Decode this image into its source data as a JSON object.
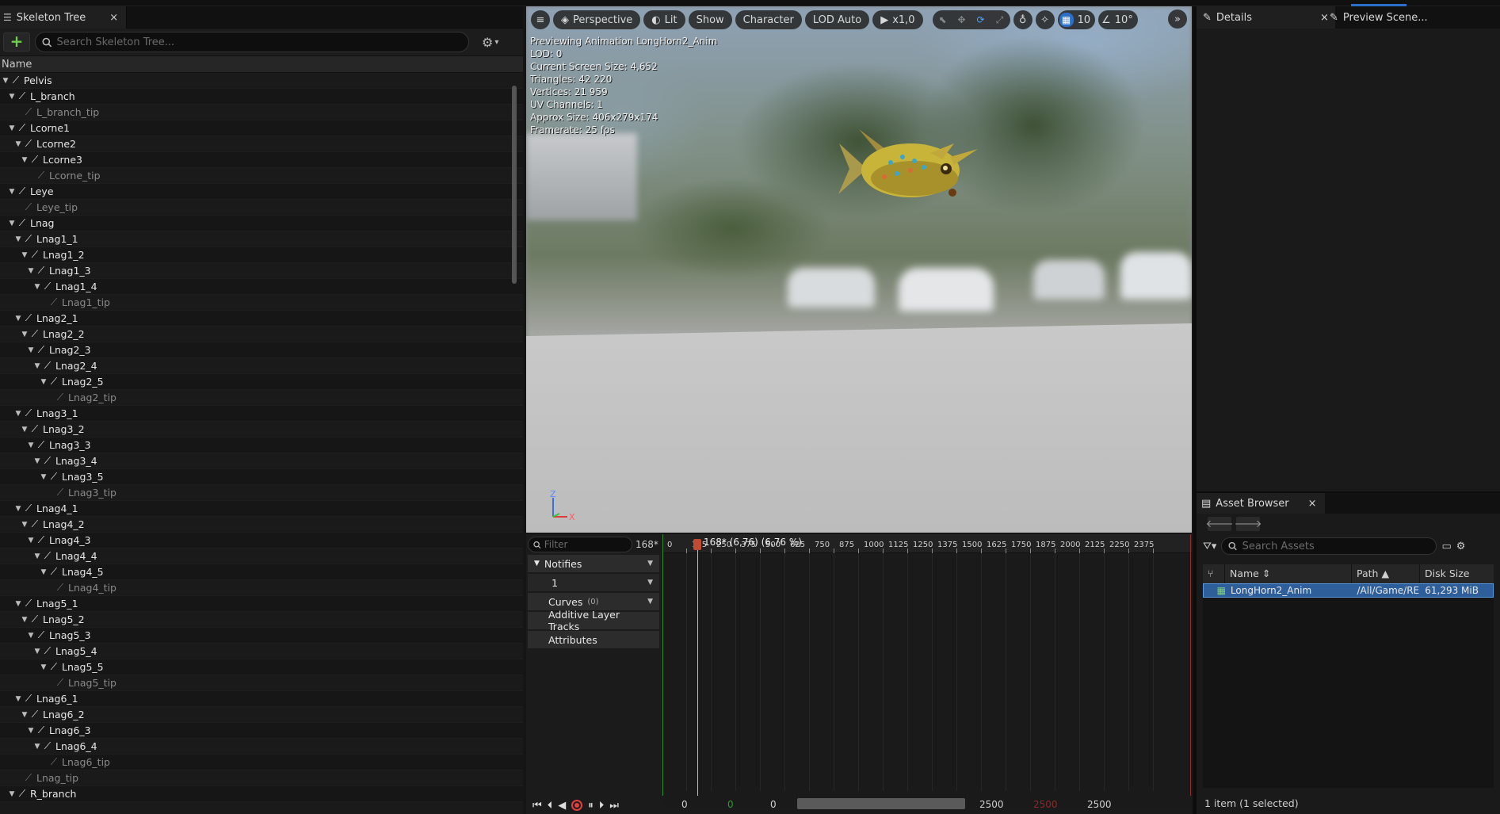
{
  "skeleton_tree": {
    "tab_label": "Skeleton Tree",
    "tab_close": "×",
    "add_label": "+",
    "search_placeholder": "Search Skeleton Tree...",
    "column_name": "Name",
    "bones": [
      {
        "label": "Pelvis",
        "depth": 0,
        "tip": false
      },
      {
        "label": "L_branch",
        "depth": 1,
        "tip": false
      },
      {
        "label": "L_branch_tip",
        "depth": 2,
        "tip": true
      },
      {
        "label": "Lcorne1",
        "depth": 1,
        "tip": false
      },
      {
        "label": "Lcorne2",
        "depth": 2,
        "tip": false
      },
      {
        "label": "Lcorne3",
        "depth": 3,
        "tip": false
      },
      {
        "label": "Lcorne_tip",
        "depth": 4,
        "tip": true
      },
      {
        "label": "Leye",
        "depth": 1,
        "tip": false
      },
      {
        "label": "Leye_tip",
        "depth": 2,
        "tip": true
      },
      {
        "label": "Lnag",
        "depth": 1,
        "tip": false
      },
      {
        "label": "Lnag1_1",
        "depth": 2,
        "tip": false
      },
      {
        "label": "Lnag1_2",
        "depth": 3,
        "tip": false
      },
      {
        "label": "Lnag1_3",
        "depth": 4,
        "tip": false
      },
      {
        "label": "Lnag1_4",
        "depth": 5,
        "tip": false
      },
      {
        "label": "Lnag1_tip",
        "depth": 6,
        "tip": true
      },
      {
        "label": "Lnag2_1",
        "depth": 2,
        "tip": false
      },
      {
        "label": "Lnag2_2",
        "depth": 3,
        "tip": false
      },
      {
        "label": "Lnag2_3",
        "depth": 4,
        "tip": false
      },
      {
        "label": "Lnag2_4",
        "depth": 5,
        "tip": false
      },
      {
        "label": "Lnag2_5",
        "depth": 6,
        "tip": false
      },
      {
        "label": "Lnag2_tip",
        "depth": 7,
        "tip": true
      },
      {
        "label": "Lnag3_1",
        "depth": 2,
        "tip": false
      },
      {
        "label": "Lnag3_2",
        "depth": 3,
        "tip": false
      },
      {
        "label": "Lnag3_3",
        "depth": 4,
        "tip": false
      },
      {
        "label": "Lnag3_4",
        "depth": 5,
        "tip": false
      },
      {
        "label": "Lnag3_5",
        "depth": 6,
        "tip": false
      },
      {
        "label": "Lnag3_tip",
        "depth": 7,
        "tip": true
      },
      {
        "label": "Lnag4_1",
        "depth": 2,
        "tip": false
      },
      {
        "label": "Lnag4_2",
        "depth": 3,
        "tip": false
      },
      {
        "label": "Lnag4_3",
        "depth": 4,
        "tip": false
      },
      {
        "label": "Lnag4_4",
        "depth": 5,
        "tip": false
      },
      {
        "label": "Lnag4_5",
        "depth": 6,
        "tip": false
      },
      {
        "label": "Lnag4_tip",
        "depth": 7,
        "tip": true
      },
      {
        "label": "Lnag5_1",
        "depth": 2,
        "tip": false
      },
      {
        "label": "Lnag5_2",
        "depth": 3,
        "tip": false
      },
      {
        "label": "Lnag5_3",
        "depth": 4,
        "tip": false
      },
      {
        "label": "Lnag5_4",
        "depth": 5,
        "tip": false
      },
      {
        "label": "Lnag5_5",
        "depth": 6,
        "tip": false
      },
      {
        "label": "Lnag5_tip",
        "depth": 7,
        "tip": true
      },
      {
        "label": "Lnag6_1",
        "depth": 2,
        "tip": false
      },
      {
        "label": "Lnag6_2",
        "depth": 3,
        "tip": false
      },
      {
        "label": "Lnag6_3",
        "depth": 4,
        "tip": false
      },
      {
        "label": "Lnag6_4",
        "depth": 5,
        "tip": false
      },
      {
        "label": "Lnag6_tip",
        "depth": 6,
        "tip": true
      },
      {
        "label": "Lnag_tip",
        "depth": 2,
        "tip": true
      },
      {
        "label": "R_branch",
        "depth": 1,
        "tip": false
      }
    ]
  },
  "viewport": {
    "menu_icon": "hamburger-icon",
    "perspective": "Perspective",
    "lit": "Lit",
    "show": "Show",
    "character": "Character",
    "lod": "LOD Auto",
    "play_speed": "x1,0",
    "grid_snap": "10",
    "angle_snap": "10°",
    "stats": [
      "Previewing Animation LongHorn2_Anim",
      "LOD: 0",
      "Current Screen Size: 4,652",
      "Triangles: 42 220",
      "Vertices: 21 959",
      "UV Channels: 1",
      "Approx Size: 406x279x174",
      "Framerate: 25 fps"
    ],
    "axis_z": "Z",
    "axis_x": "X"
  },
  "sequencer": {
    "filter_placeholder": "Filter",
    "frame_readout": "168*",
    "notifies": "Notifies",
    "notify_track": "1",
    "curves": "Curves",
    "curves_count": "(0)",
    "additive": "Additive Layer Tracks",
    "attributes": "Attributes",
    "playhead_label": "168* (6,76) (6,76 %)",
    "ruler_ticks": [
      "0",
      "125",
      "250",
      "375",
      "500",
      "625",
      "750",
      "875",
      "1000",
      "1125",
      "1250",
      "1375",
      "1500",
      "1625",
      "1750",
      "1875",
      "2000",
      "2125",
      "2250",
      "2375"
    ],
    "range_left": "0",
    "range_green": "0",
    "range_view_start": "0",
    "range_view_end": "2500",
    "range_red": "2500",
    "range_right": "2500"
  },
  "right_panel": {
    "details_tab": "Details",
    "preview_tab": "Preview Scene...",
    "close": "×"
  },
  "asset_browser": {
    "tab_label": "Asset Browser",
    "search_placeholder": "Search Assets",
    "col_name": "Name",
    "col_path": "Path",
    "col_size": "Disk Size",
    "row_name": "LongHorn2_Anim",
    "row_path": "/All/Game/RE",
    "row_size": "61,293 MiB",
    "status": "1 item (1 selected)"
  },
  "colors": {
    "accent_blue": "#2a6fc9",
    "selection": "#2f5f9a",
    "add_green": "#6fcf4a",
    "record_red": "#e04040"
  }
}
